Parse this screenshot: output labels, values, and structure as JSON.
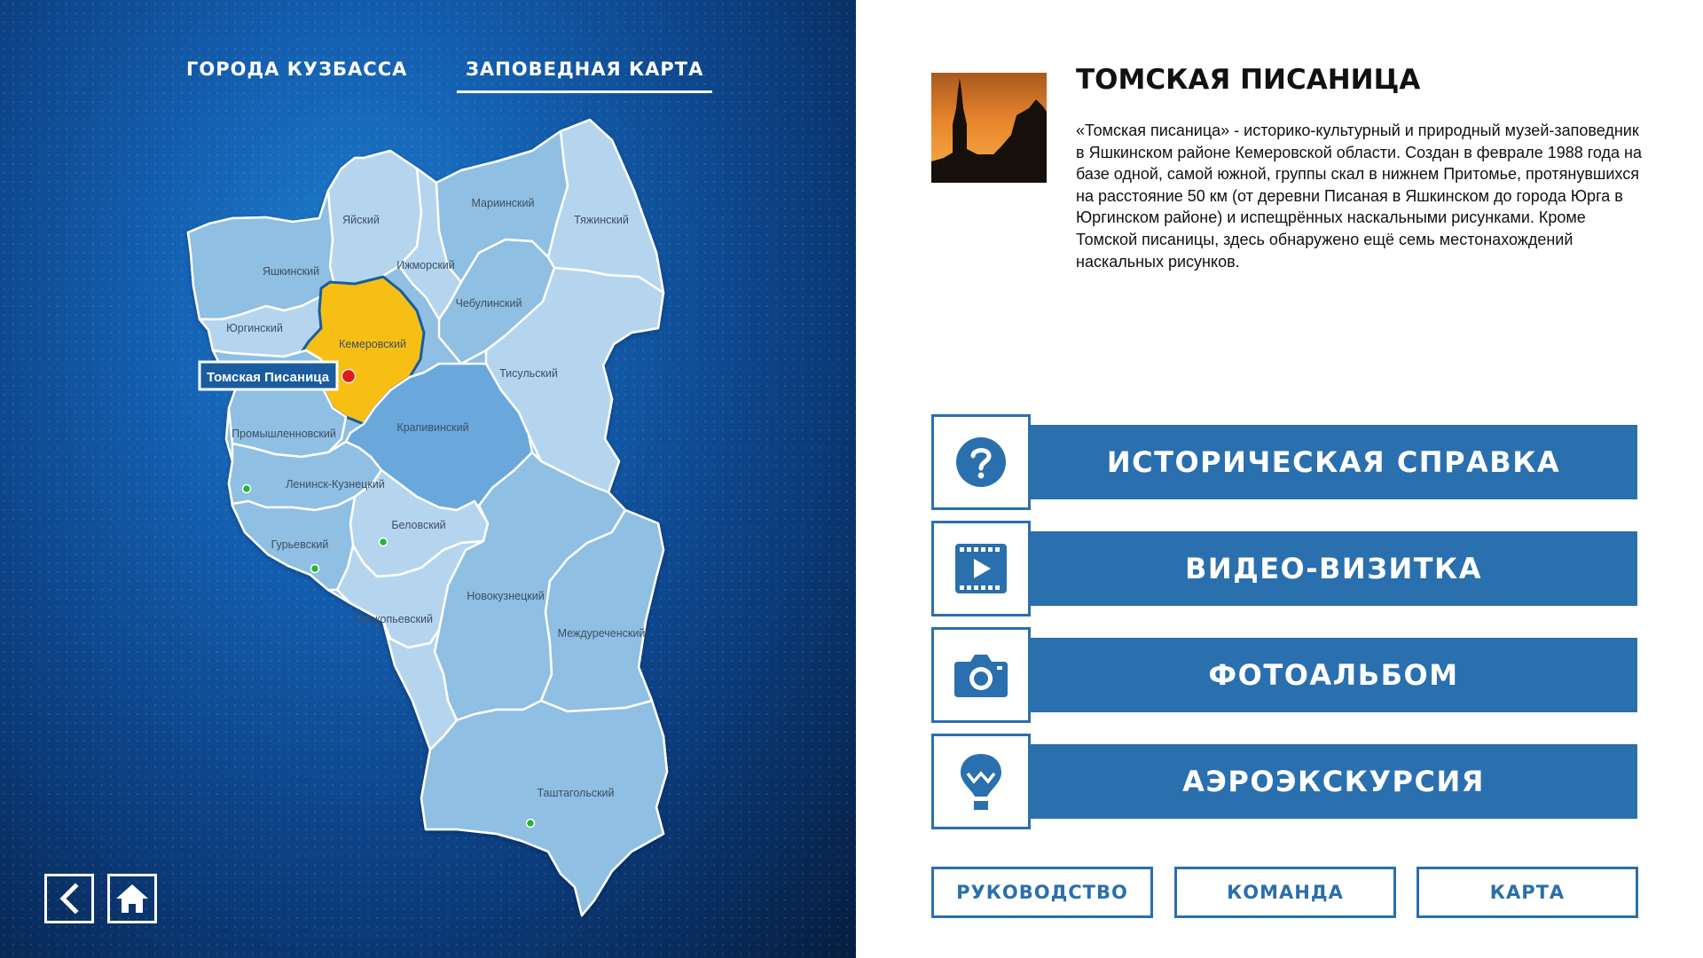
{
  "nav": {
    "tabs": [
      {
        "label": "ГОРОДА КУЗБАССА",
        "active": false
      },
      {
        "label": "ЗАПОВЕДНАЯ КАРТА",
        "active": true
      }
    ]
  },
  "map": {
    "districts": {
      "yaysky": "Яйский",
      "mariinsky": "Мариинский",
      "tyazhinsky": "Тяжинский",
      "yashkinsky": "Яшкинский",
      "izhmorsky": "Ижморский",
      "chebulinsky": "Чебулинский",
      "yurginsky": "Юргинский",
      "kemerovsky": "Кемеровский",
      "tisulsky": "Тисульский",
      "krapivinsky": "Крапивинский",
      "promyshlennovsky": "Промышленновский",
      "leninsk": "Ленинск-Кузнецкий",
      "belovsky": "Беловский",
      "guryevsky": "Гурьевский",
      "novokuznetsky": "Новокузнецкий",
      "prokopyevsky": "Прокопьевский",
      "mezhdurechensky": "Междуреченский",
      "tashtagolsky": "Таштагольский"
    },
    "selected_site_label": "Томская Писаница",
    "colors": {
      "region_fill": "#8fbfe2",
      "region_light": "#b5d5ee",
      "region_mid": "#6aa8dc",
      "selected_fill": "#f7bf14",
      "marker_red": "#e01b1b",
      "marker_green": "#27b33a"
    }
  },
  "bottom_nav": {
    "back_icon": "chevron-left-icon",
    "home_icon": "home-icon"
  },
  "site": {
    "title": "ТОМСКАЯ ПИСАНИЦА",
    "description": "«Томская писаница» - историко-культурный и природный музей-заповедник в Яшкинском районе Кемеровской области. Создан в феврале 1988 года на базе одной, самой южной, группы скал в нижнем Притомье, протянувшихся на расстояние 50 км (от деревни Писаная в Яшкинском до города Юрга в Юргинском районе) и испещрённых наскальными рисунками. Кроме Томской писаницы, здесь обнаружено ещё семь местонахождений наскальных рисунков."
  },
  "menu": [
    {
      "label": "ИСТОРИЧЕСКАЯ СПРАВКА",
      "icon": "question-icon"
    },
    {
      "label": "ВИДЕО-ВИЗИТКА",
      "icon": "video-icon"
    },
    {
      "label": "ФОТОАЛЬБОМ",
      "icon": "camera-icon"
    },
    {
      "label": "АЭРОЭКСКУРСИЯ",
      "icon": "balloon-icon"
    }
  ],
  "footer": {
    "guide": "РУКОВОДСТВО",
    "team": "КОМАНДА",
    "map": "КАРТА"
  },
  "accent_color": "#2a6fae"
}
